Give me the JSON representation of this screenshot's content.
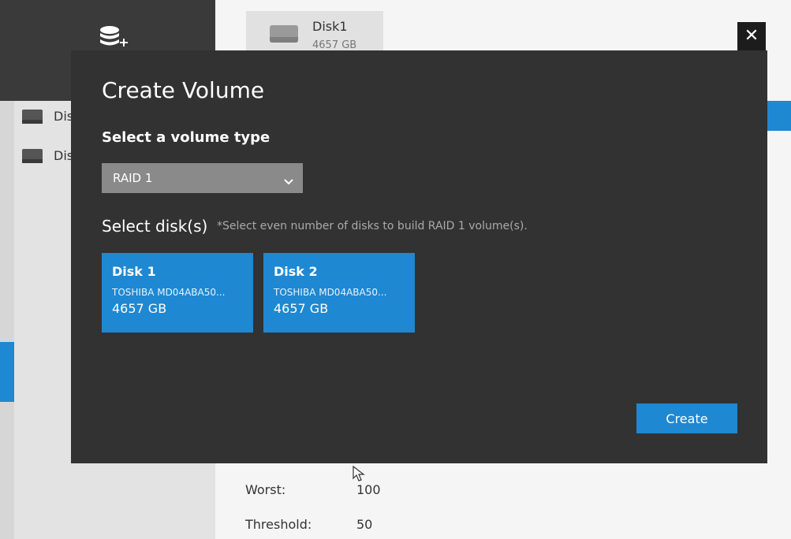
{
  "background": {
    "tab": {
      "title": "Disk1",
      "size": "4657 GB"
    },
    "sidebar": {
      "items": [
        {
          "label": "Dis"
        },
        {
          "label": "Dis"
        }
      ]
    },
    "stats": [
      {
        "label": "Worst:",
        "value": "100"
      },
      {
        "label": "Threshold:",
        "value": "50"
      }
    ]
  },
  "modal": {
    "close_label": "✕",
    "title": "Create Volume",
    "volume_type_label": "Select a volume type",
    "volume_type_selected": "RAID 1",
    "disks_label": "Select disk(s)",
    "disks_hint": "*Select even number of disks to build RAID 1 volume(s).",
    "disks": [
      {
        "name": "Disk 1",
        "model": "TOSHIBA MD04ABA50...",
        "size": "4657 GB"
      },
      {
        "name": "Disk 2",
        "model": "TOSHIBA MD04ABA50...",
        "size": "4657 GB"
      }
    ],
    "create_label": "Create"
  },
  "icons": [
    "database-add-icon",
    "chevron-down-icon",
    "close-icon",
    "hard-disk-icon",
    "cursor-icon"
  ],
  "colors": {
    "accent": "#1e88d2",
    "modal_bg": "#323232",
    "select_bg": "#8a8a8a"
  }
}
